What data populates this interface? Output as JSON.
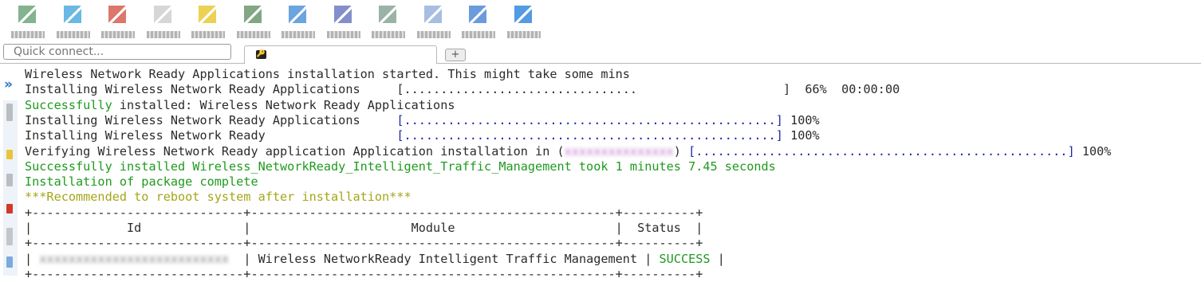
{
  "toolbar": {
    "items": [
      {
        "icon": "pixelated-toolbar-icon",
        "label": "",
        "color": "#5a9a6a"
      },
      {
        "icon": "pixelated-toolbar-icon",
        "label": "",
        "color": "#3aa0d8"
      },
      {
        "icon": "pixelated-toolbar-icon",
        "label": "",
        "color": "#d04a3a"
      },
      {
        "icon": "pixelated-toolbar-icon",
        "label": "",
        "color": "#c8c8c8"
      },
      {
        "icon": "pixelated-toolbar-icon",
        "label": "",
        "color": "#e6c21a"
      },
      {
        "icon": "pixelated-toolbar-icon",
        "label": "",
        "color": "#5a8a5a"
      },
      {
        "icon": "pixelated-toolbar-icon",
        "label": "",
        "color": "#3a86d4"
      },
      {
        "icon": "pixelated-toolbar-icon",
        "label": "",
        "color": "#5a6ab8"
      },
      {
        "icon": "pixelated-toolbar-icon",
        "label": "",
        "color": "#7a9a8a"
      },
      {
        "icon": "pixelated-toolbar-icon",
        "label": "",
        "color": "#8aa8d8"
      },
      {
        "icon": "pixelated-toolbar-icon",
        "label": "",
        "color": "#3a7ad0"
      },
      {
        "icon": "pixelated-toolbar-icon",
        "label": "",
        "color": "#1a7ad8"
      }
    ]
  },
  "quick_connect": {
    "placeholder": "Quick connect..."
  },
  "session_tab": {
    "title": "",
    "new_tab_symbol": "+",
    "key_icon": "🔑"
  },
  "gutter": {
    "chevron": "»"
  },
  "terminal": {
    "lines": [
      {
        "parts": [
          {
            "t": "Wireless Network Ready Applications installation started. This might take some mins",
            "c": ""
          }
        ]
      },
      {
        "parts": [
          {
            "t": "Installing Wireless Network Ready Applications     [................................                    ]  66%  00:00:00",
            "c": ""
          }
        ]
      },
      {
        "parts": [
          {
            "t": "Successfully",
            "c": "green"
          },
          {
            "t": " installed: Wireless Network Ready Applications",
            "c": ""
          }
        ]
      },
      {
        "parts": [
          {
            "t": "Installing Wireless Network Ready Applications     ",
            "c": ""
          },
          {
            "t": "[...................................................]",
            "c": "blue"
          },
          {
            "t": " 100%",
            "c": ""
          }
        ]
      },
      {
        "parts": [
          {
            "t": "Installing Wireless Network Ready                  ",
            "c": ""
          },
          {
            "t": "[...................................................]",
            "c": "blue"
          },
          {
            "t": " 100%",
            "c": ""
          }
        ]
      },
      {
        "parts": [
          {
            "t": "Verifying Wireless Network Ready application Application installation in (",
            "c": ""
          },
          {
            "t": "xxxxxxxxxxxxxxx",
            "c": "blurred-purple"
          },
          {
            "t": ") ",
            "c": ""
          },
          {
            "t": "[...................................................]",
            "c": "blue"
          },
          {
            "t": " 100%",
            "c": ""
          }
        ]
      },
      {
        "parts": [
          {
            "t": "Successfully installed Wireless_NetworkReady_Intelligent_Traffic_Management took 1 minutes 7.45 seconds",
            "c": "green"
          }
        ]
      },
      {
        "parts": [
          {
            "t": "Installation of package complete",
            "c": "green"
          }
        ]
      },
      {
        "parts": [
          {
            "t": "***Recommended to reboot system after installation***",
            "c": "olive"
          }
        ]
      },
      {
        "parts": [
          {
            "t": "+-----------------------------+--------------------------------------------------+----------+",
            "c": ""
          }
        ]
      },
      {
        "parts": [
          {
            "t": "|             Id              |                      Module                      |  Status  |",
            "c": ""
          }
        ]
      },
      {
        "parts": [
          {
            "t": "+-----------------------------+--------------------------------------------------+----------+",
            "c": ""
          }
        ]
      },
      {
        "parts": [
          {
            "t": "| ",
            "c": ""
          },
          {
            "t": "xxxxxxxxxxxxxxxxxxxxxxxxxx",
            "c": "blurred"
          },
          {
            "t": "  | Wireless NetworkReady Intelligent Traffic Management | ",
            "c": ""
          },
          {
            "t": "SUCCESS",
            "c": "green"
          },
          {
            "t": " |",
            "c": ""
          }
        ]
      },
      {
        "parts": [
          {
            "t": "+-----------------------------+--------------------------------------------------+----------+",
            "c": ""
          }
        ]
      }
    ]
  }
}
